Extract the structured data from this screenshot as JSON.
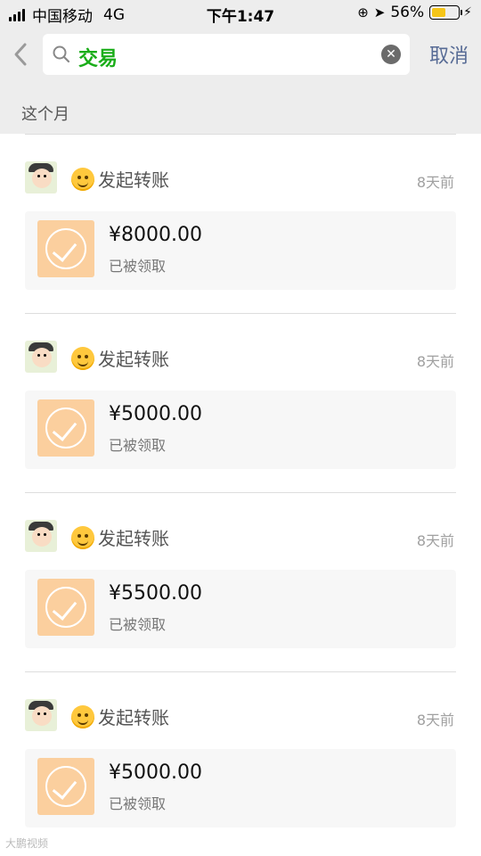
{
  "status_bar": {
    "carrier": "中国移动",
    "network": "4G",
    "time": "下午1:47",
    "battery_percent": "56%",
    "battery_level": 0.56,
    "accent_battery": "#f5c518"
  },
  "search": {
    "back_icon": "chevron-left-icon",
    "search_icon": "search-icon",
    "query": "交易",
    "clear_icon": "clear-icon",
    "cancel_label": "取消",
    "query_color": "#1aad19"
  },
  "section": {
    "title": "这个月"
  },
  "items": [
    {
      "title": "发起转账",
      "time": "8天前",
      "amount": "¥8000.00",
      "status": "已被领取"
    },
    {
      "title": "发起转账",
      "time": "8天前",
      "amount": "¥5000.00",
      "status": "已被领取"
    },
    {
      "title": "发起转账",
      "time": "8天前",
      "amount": "¥5500.00",
      "status": "已被领取"
    },
    {
      "title": "发起转账",
      "time": "8天前",
      "amount": "¥5000.00",
      "status": "已被领取"
    }
  ],
  "watermark": "大鹏视频"
}
